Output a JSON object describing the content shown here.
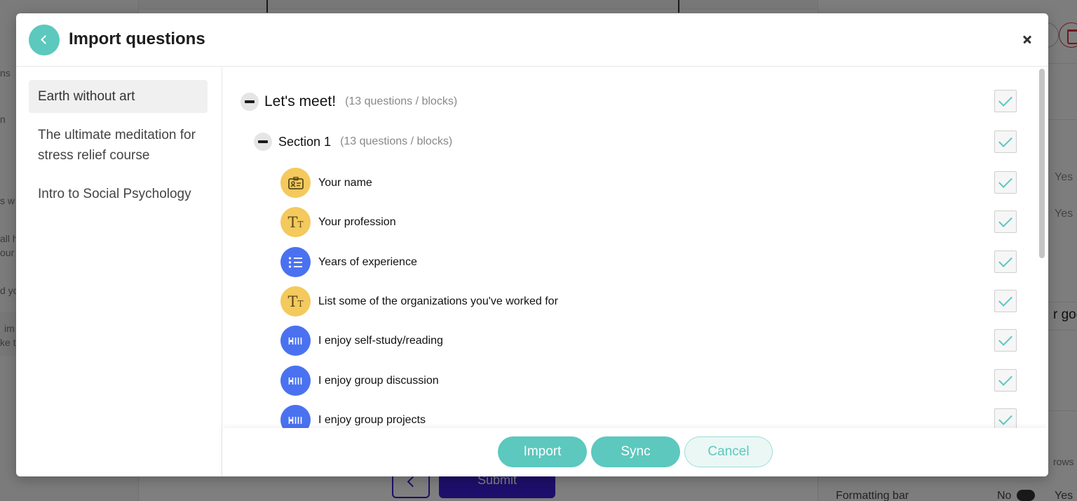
{
  "background": {
    "left_fragments": [
      "ns",
      "n",
      "s w",
      "all h",
      "our",
      "d yo",
      "im",
      "ke t"
    ],
    "right_fragments": [
      "Yes",
      "Yes",
      "r goe",
      "rows",
      "Formatting bar",
      "No",
      "Yes"
    ],
    "submit_label": "Submit"
  },
  "modal": {
    "title": "Import questions",
    "courses": [
      {
        "label": "Earth without art",
        "active": true
      },
      {
        "label": "The ultimate meditation for stress relief course",
        "active": false
      },
      {
        "label": "Intro to Social Psychology",
        "active": false
      }
    ],
    "group": {
      "title": "Let's meet!",
      "count": "(13 questions / blocks)",
      "checked": true
    },
    "section": {
      "title": "Section 1",
      "count": "(13 questions / blocks)",
      "checked": true
    },
    "questions": [
      {
        "title": "Your name",
        "icon": "id-card-icon",
        "color": "#f4c95d",
        "checked": true
      },
      {
        "title": "Your profession",
        "icon": "text-icon",
        "color": "#f4c95d",
        "checked": true
      },
      {
        "title": "Years of experience",
        "icon": "list-icon",
        "color": "#4a72f0",
        "checked": true
      },
      {
        "title": "List some of the organizations you've worked for",
        "icon": "text-icon",
        "color": "#f4c95d",
        "checked": true
      },
      {
        "title": "I enjoy self-study/reading",
        "icon": "scale-icon",
        "color": "#4a72f0",
        "checked": true
      },
      {
        "title": "I enjoy group discussion",
        "icon": "scale-icon",
        "color": "#4a72f0",
        "checked": true
      },
      {
        "title": "I enjoy group projects",
        "icon": "scale-icon",
        "color": "#4a72f0",
        "checked": true
      }
    ],
    "buttons": {
      "import": "Import",
      "sync": "Sync",
      "cancel": "Cancel"
    },
    "accent_color": "#5cc8be"
  }
}
